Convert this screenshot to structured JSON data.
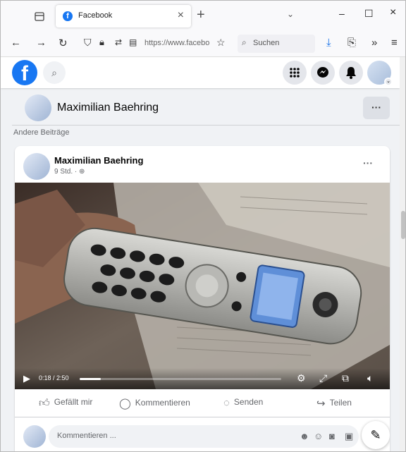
{
  "browser": {
    "tab_title": "Facebook",
    "tab_close": "×",
    "new_tab": "+",
    "tab_menu": "⌄",
    "url": "https://www.facebo",
    "search_placeholder": "Suchen",
    "window_controls": {
      "minimize": "–",
      "maximize": "☐",
      "close": "×"
    }
  },
  "fb_header": {
    "logo_letter": "f",
    "icons": [
      "grid-menu-icon",
      "messenger-icon",
      "bell-icon"
    ]
  },
  "profile_bar": {
    "name": "Maximilian Baehring",
    "more_label": "···"
  },
  "section_label": "Andere Beiträge",
  "post": {
    "author": "Maximilian Baehring",
    "meta": "9 Std. · ",
    "more_label": "···",
    "video": {
      "time": "0:18 / 2:50",
      "progress": 0.106
    },
    "actions": {
      "like": "Gefällt mir",
      "comment": "Kommentieren",
      "send": "Senden",
      "share": "Teilen"
    },
    "comment_placeholder": "Kommentieren ..."
  }
}
